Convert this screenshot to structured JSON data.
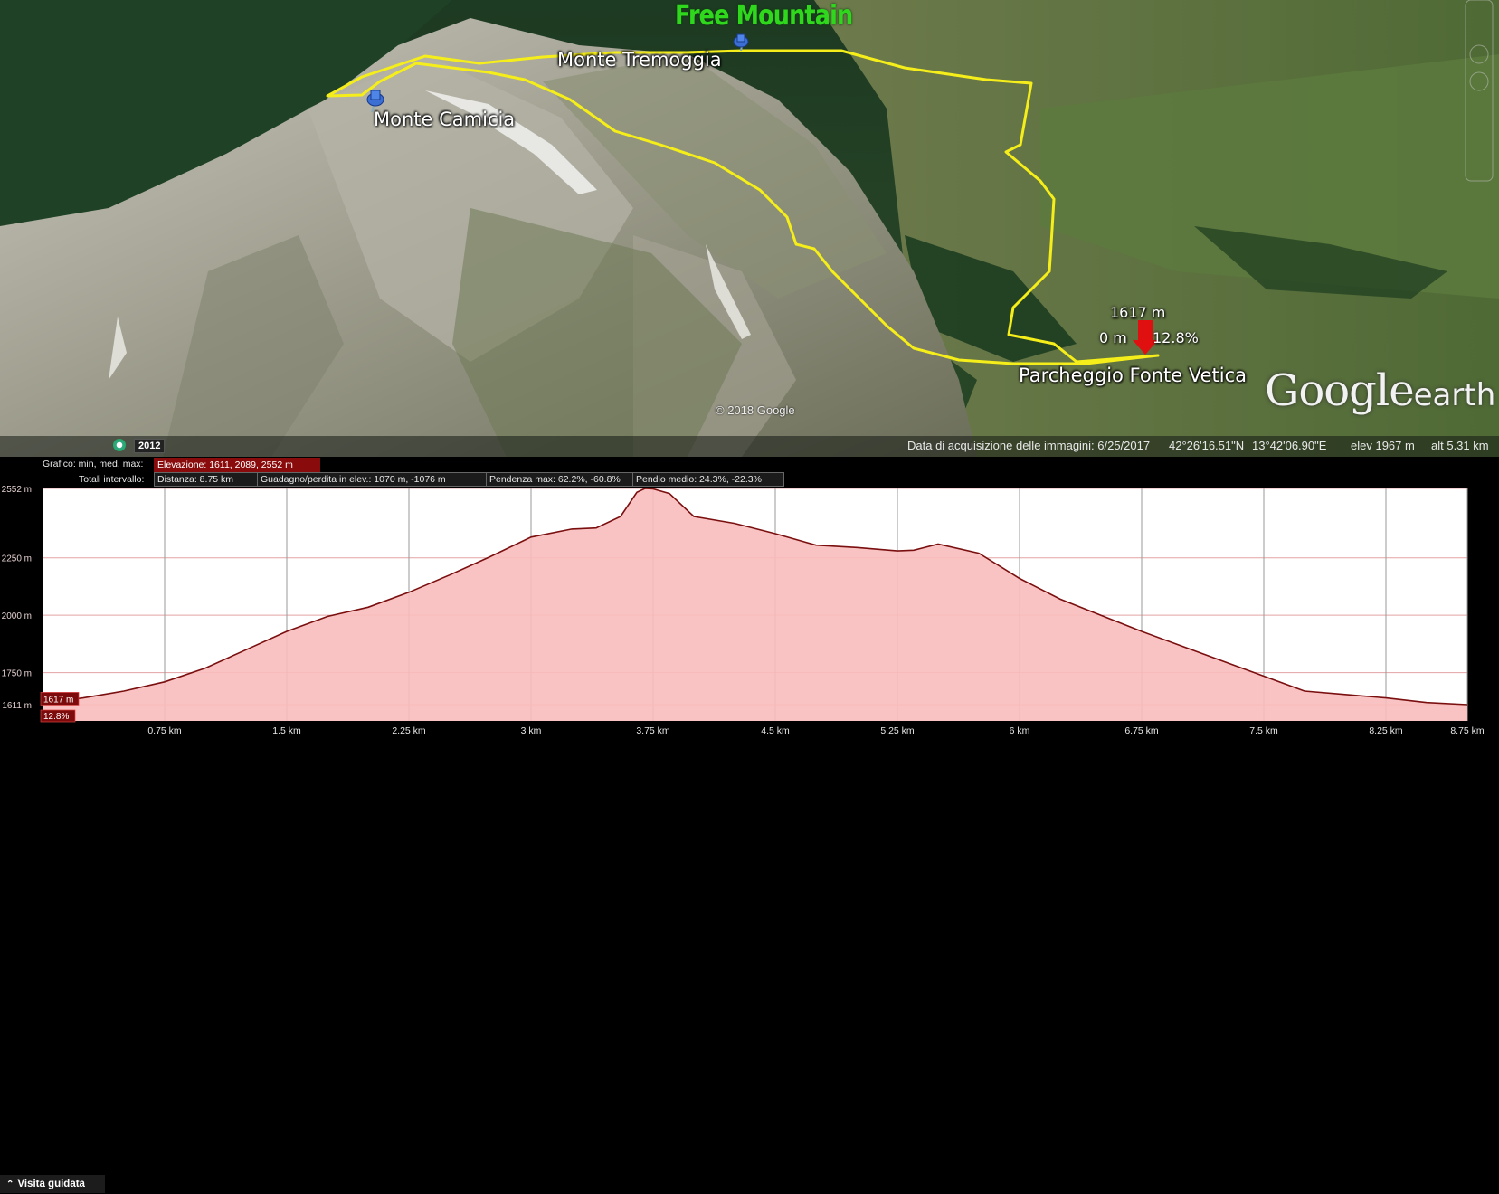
{
  "map": {
    "watermark": "Free Mountain",
    "placemarks": [
      {
        "label": "Monte Tremoggia"
      },
      {
        "label": "Monte Camicia"
      },
      {
        "label": "Parcheggio Fonte Vetica"
      }
    ],
    "cursor": {
      "elevation": "1617 m",
      "distance": "0 m",
      "slope": "12.8%"
    },
    "copyright": "© 2018 Google",
    "logo": {
      "google": "Google",
      "earth": "earth"
    },
    "year_badge": "2012",
    "status": {
      "acquisition_date": "Data di acquisizione delle immagini: 6/25/2017",
      "latitude": "42°26'16.51\"N",
      "longitude": "13°42'06.90\"E",
      "elev": "elev  1967 m",
      "alt": "alt  5.31 km"
    },
    "colors": {
      "track": "#f5ee1a",
      "pin": "#3b6fd4",
      "cursor_arrow": "#e01010"
    }
  },
  "elevation_panel": {
    "graph_label": "Grafico: min, med, max:",
    "graph_value": "Elevazione: 1611, 2089, 2552 m",
    "totals_label": "Totali intervallo:",
    "stats": {
      "distance": "Distanza: 8.75 km",
      "gain_loss": "Guadagno/perdita in elev.: 1070 m, -1076 m",
      "max_slope": "Pendenza max: 62.2%, -60.8%",
      "avg_slope": "Pendio medio: 24.3%, -22.3%"
    },
    "guided_tour": "Visita guidata"
  },
  "chart_data": {
    "type": "area",
    "title": "",
    "xlabel": "",
    "ylabel": "",
    "x_unit": "km",
    "y_unit": "m",
    "xlim": [
      0,
      8.75
    ],
    "ylim": [
      1540,
      2552
    ],
    "y_ticks": [
      {
        "value": 2552,
        "label": "2552 m"
      },
      {
        "value": 2250,
        "label": "2250 m"
      },
      {
        "value": 2000,
        "label": "2000 m"
      },
      {
        "value": 1750,
        "label": "1750 m"
      },
      {
        "value": 1611,
        "label": "1611 m"
      }
    ],
    "x_ticks": [
      {
        "value": 0.75,
        "label": "0.75 km"
      },
      {
        "value": 1.5,
        "label": "1.5 km"
      },
      {
        "value": 2.25,
        "label": "2.25 km"
      },
      {
        "value": 3,
        "label": "3 km"
      },
      {
        "value": 3.75,
        "label": "3.75 km"
      },
      {
        "value": 4.5,
        "label": "4.5 km"
      },
      {
        "value": 5.25,
        "label": "5.25 km"
      },
      {
        "value": 6,
        "label": "6 km"
      },
      {
        "value": 6.75,
        "label": "6.75 km"
      },
      {
        "value": 7.5,
        "label": "7.5 km"
      },
      {
        "value": 8.25,
        "label": "8.25 km"
      },
      {
        "value": 8.75,
        "label": "8.75 km"
      }
    ],
    "cursor": {
      "x": 0,
      "y": 1617,
      "label": "1617 m",
      "slope_label": "12.8%"
    },
    "series": [
      {
        "color": "#7a0f0f",
        "fill": "#f9bcbc",
        "x": [
          0,
          0.25,
          0.5,
          0.75,
          1.0,
          1.25,
          1.5,
          1.75,
          2.0,
          2.25,
          2.5,
          2.75,
          3.0,
          3.25,
          3.4,
          3.55,
          3.65,
          3.7,
          3.75,
          3.85,
          4.0,
          4.25,
          4.5,
          4.75,
          5.0,
          5.25,
          5.35,
          5.5,
          5.75,
          6.0,
          6.25,
          6.5,
          6.75,
          7.0,
          7.25,
          7.5,
          7.75,
          8.0,
          8.25,
          8.5,
          8.75
        ],
        "y": [
          1617,
          1640,
          1670,
          1710,
          1770,
          1850,
          1930,
          1995,
          2035,
          2100,
          2175,
          2255,
          2340,
          2375,
          2380,
          2430,
          2535,
          2552,
          2550,
          2530,
          2430,
          2400,
          2355,
          2305,
          2295,
          2280,
          2283,
          2310,
          2270,
          2160,
          2070,
          2000,
          1930,
          1865,
          1800,
          1735,
          1670,
          1655,
          1640,
          1620,
          1611
        ]
      }
    ]
  }
}
